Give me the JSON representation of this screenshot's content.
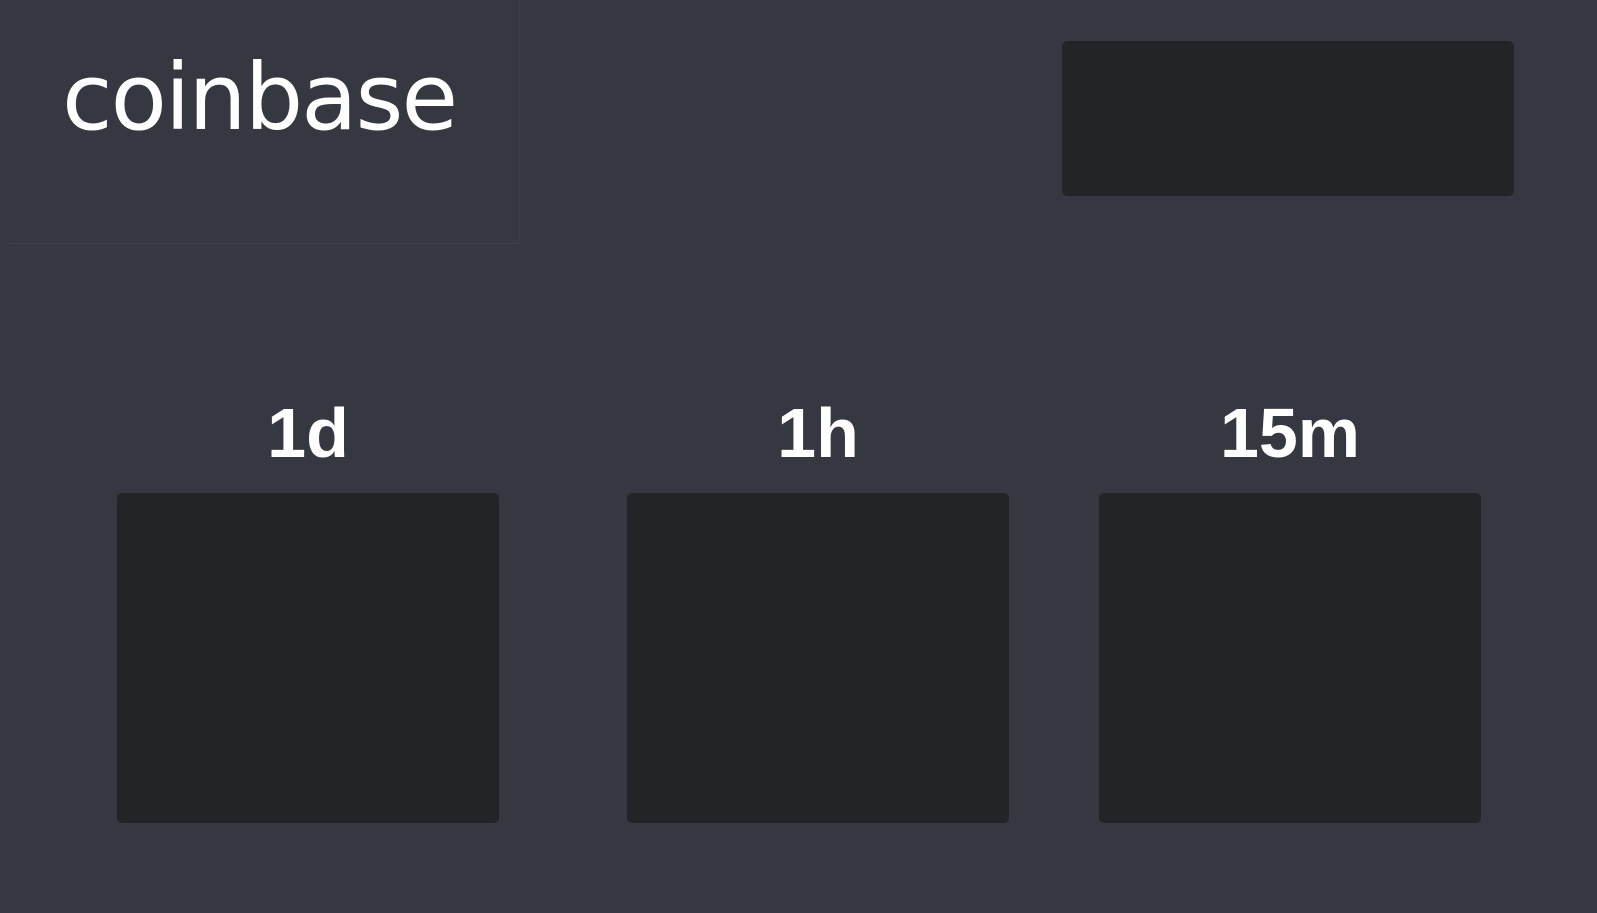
{
  "brand": {
    "logo_text": "coinbase"
  },
  "timeframes": [
    {
      "label": "1d"
    },
    {
      "label": "1h"
    },
    {
      "label": "15m"
    }
  ],
  "colors": {
    "background": "#363841",
    "panel": "#232428",
    "text": "#ffffff"
  }
}
